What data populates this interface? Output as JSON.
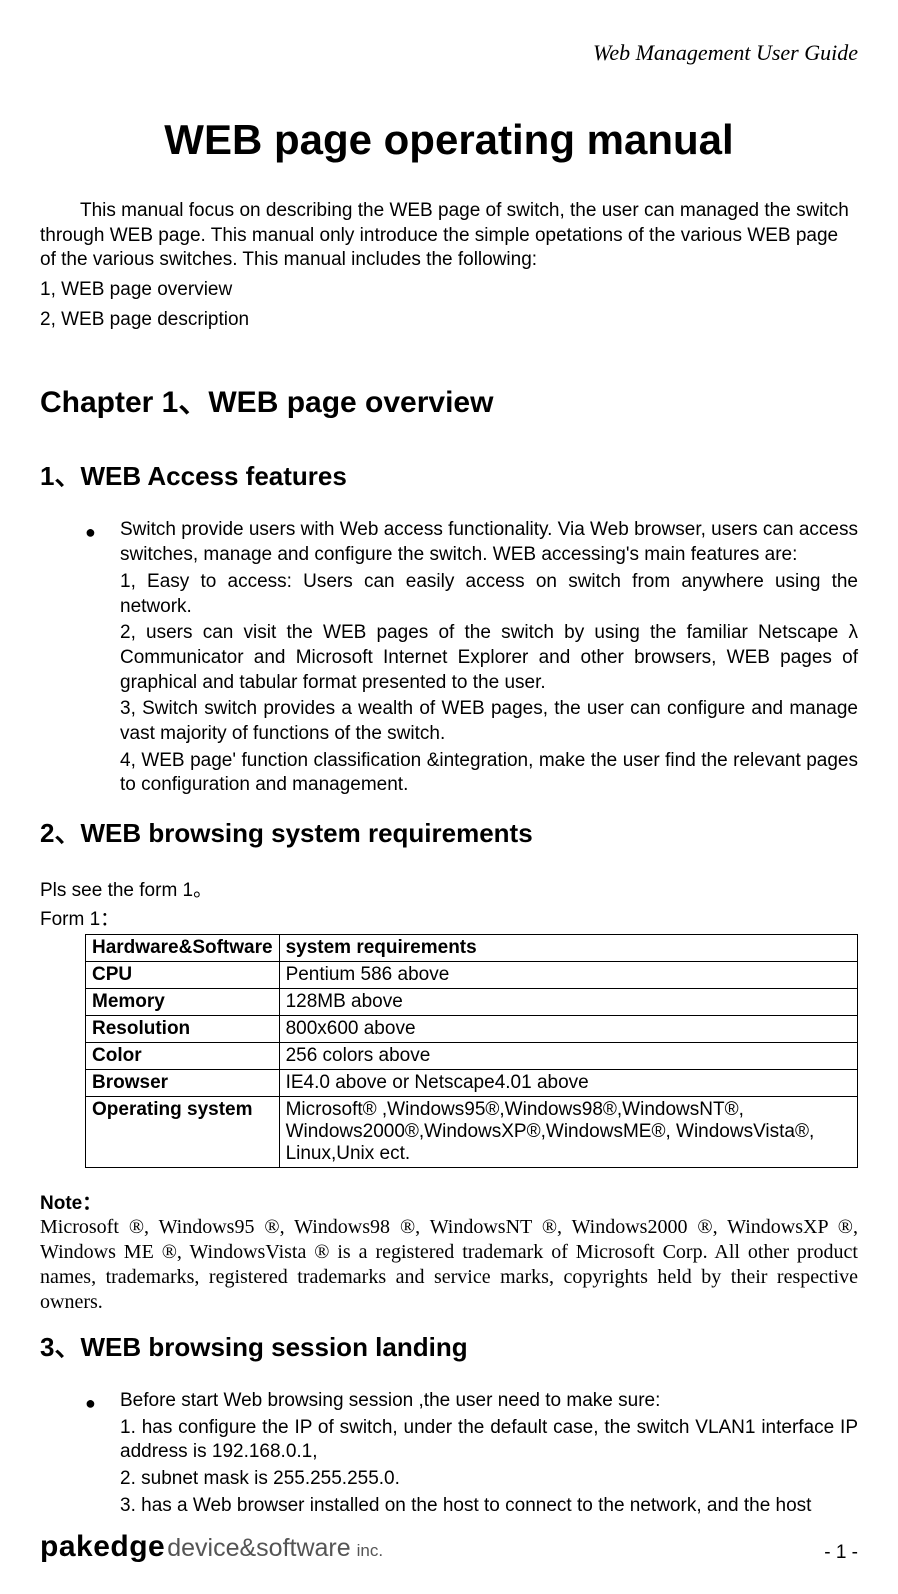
{
  "header": {
    "right": "Web Management User Guide"
  },
  "title": "WEB page operating manual",
  "intro": {
    "p1": "This manual focus on describing the WEB page of switch, the user can managed the switch through WEB page. This manual only introduce the simple opetations of the various WEB page of the various switches. This manual includes the following:",
    "i1": "1, WEB page overview",
    "i2": "2, WEB page description"
  },
  "chapter1": {
    "title": "Chapter 1、WEB page overview",
    "s1": {
      "title": "1、WEB Access features",
      "lead": "Switch provide users with Web access functionality. Via Web browser, users can access switches, manage and configure the switch. WEB accessing's main features are:",
      "p1": "1, Easy to access: Users can easily access on switch from anywhere using the network.",
      "p2": "2, users can visit the WEB pages of the switch by using the familiar Netscape λ Communicator and Microsoft Internet Explorer and other browsers, WEB pages of graphical and tabular format presented to the user.",
      "p3": "3, Switch switch provides a wealth of WEB  pages, the user can configure and manage vast majority of functions of the switch.",
      "p4": "4, WEB page' function classification &integration, make the user find the relevant pages to configuration and management."
    },
    "s2": {
      "title": "2、WEB browsing system requirements",
      "intro1": "Pls see the form 1。",
      "intro2": "Form 1：",
      "table": {
        "header": [
          "Hardware&Software",
          "system requirements"
        ],
        "rows": [
          [
            "CPU",
            "Pentium 586 above"
          ],
          [
            "Memory",
            "128MB above"
          ],
          [
            "Resolution",
            "800x600 above"
          ],
          [
            "Color",
            "256 colors above"
          ],
          [
            "Browser",
            "IE4.0 above or Netscape4.01 above"
          ],
          [
            "Operating system",
            "Microsoft® ,Windows95®,Windows98®,WindowsNT®, Windows2000®,WindowsXP®,WindowsME®, WindowsVista®, Linux,Unix ect."
          ]
        ]
      },
      "note_label": "Note：",
      "note_body": "Microsoft ®, Windows95 ®, Windows98 ®, WindowsNT ®, Windows2000 ®, WindowsXP ®, Windows ME ®, WindowsVista ® is a registered trademark of Microsoft Corp. All other product names, trademarks, registered trademarks and service marks, copyrights held by their respective owners."
    },
    "s3": {
      "title": "3、WEB browsing session landing",
      "lead": "Before start Web browsing session ,the user need to make sure:",
      "p1": "1. has configure the IP of switch, under the  default case, the switch VLAN1 interface IP address is 192.168.0.1,",
      "p2": "2. subnet mask is 255.255.255.0.",
      "p3": "3. has a Web browser installed on the host to  connect to the network, and the host"
    }
  },
  "footer": {
    "logo_bold": "pakedge",
    "logo_light": "device&software",
    "logo_inc": "inc.",
    "page": "- 1 -"
  }
}
